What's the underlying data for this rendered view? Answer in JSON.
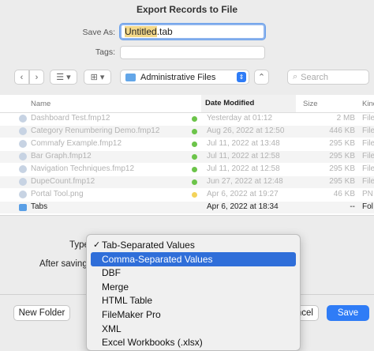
{
  "window": {
    "title": "Export Records to File"
  },
  "save": {
    "save_as_label": "Save As:",
    "filename_base": "Untitled",
    "filename_ext": ".tab",
    "tags_label": "Tags:"
  },
  "toolbar": {
    "back": "‹",
    "forward": "›",
    "list_view": "☰ ▾",
    "grid_view": "⊞ ▾",
    "location": "Administrative Files",
    "stepper": "⇕",
    "collapse": "⌃",
    "search_placeholder": "Search"
  },
  "columns": {
    "name": "Name",
    "date": "Date Modified",
    "size": "Size",
    "kind": "Kind"
  },
  "files": [
    {
      "name": "Dashboard Test.fmp12",
      "date": "Yesterday at 01:12",
      "size": "2 MB",
      "kind": "File",
      "tag": "#6cc44a"
    },
    {
      "name": "Category Renumbering Demo.fmp12",
      "date": "Aug 26, 2022 at 12:50",
      "size": "446 KB",
      "kind": "File",
      "tag": "#6cc44a"
    },
    {
      "name": "Commafy Example.fmp12",
      "date": "Jul 11, 2022 at 13:48",
      "size": "295 KB",
      "kind": "File",
      "tag": "#6cc44a"
    },
    {
      "name": "Bar Graph.fmp12",
      "date": "Jul 11, 2022 at 12:58",
      "size": "295 KB",
      "kind": "File",
      "tag": "#6cc44a"
    },
    {
      "name": "Navigation Techniques.fmp12",
      "date": "Jul 11, 2022 at 12:58",
      "size": "295 KB",
      "kind": "File",
      "tag": "#6cc44a"
    },
    {
      "name": "DupeCount.fmp12",
      "date": "Jun 27, 2022 at 12:48",
      "size": "295 KB",
      "kind": "File",
      "tag": "#6cc44a"
    },
    {
      "name": "Portal Tool.png",
      "date": "Apr 6, 2022 at 19:27",
      "size": "46 KB",
      "kind": "PN",
      "tag": "#f3d35a"
    },
    {
      "name": "Tabs",
      "date": "Apr 6, 2022 at 18:34",
      "size": "--",
      "kind": "Fol",
      "tag": ""
    }
  ],
  "options": {
    "type_label": "Type",
    "after_saving_label": "After saving:"
  },
  "type_menu": {
    "items": [
      "Tab-Separated Values",
      "Comma-Separated Values",
      "DBF",
      "Merge",
      "HTML Table",
      "FileMaker Pro",
      "XML",
      "Excel Workbooks (.xlsx)"
    ],
    "checked_index": 0,
    "highlighted_index": 1,
    "check_mark": "✓"
  },
  "buttons": {
    "new_folder": "New Folder",
    "cancel": "Cancel",
    "cancel_visible": "ncel",
    "save": "Save"
  },
  "colors": {
    "accent": "#2f7cf6",
    "highlight": "#2f6ed9",
    "tag_green": "#6cc44a",
    "tag_yellow": "#f3d35a"
  }
}
